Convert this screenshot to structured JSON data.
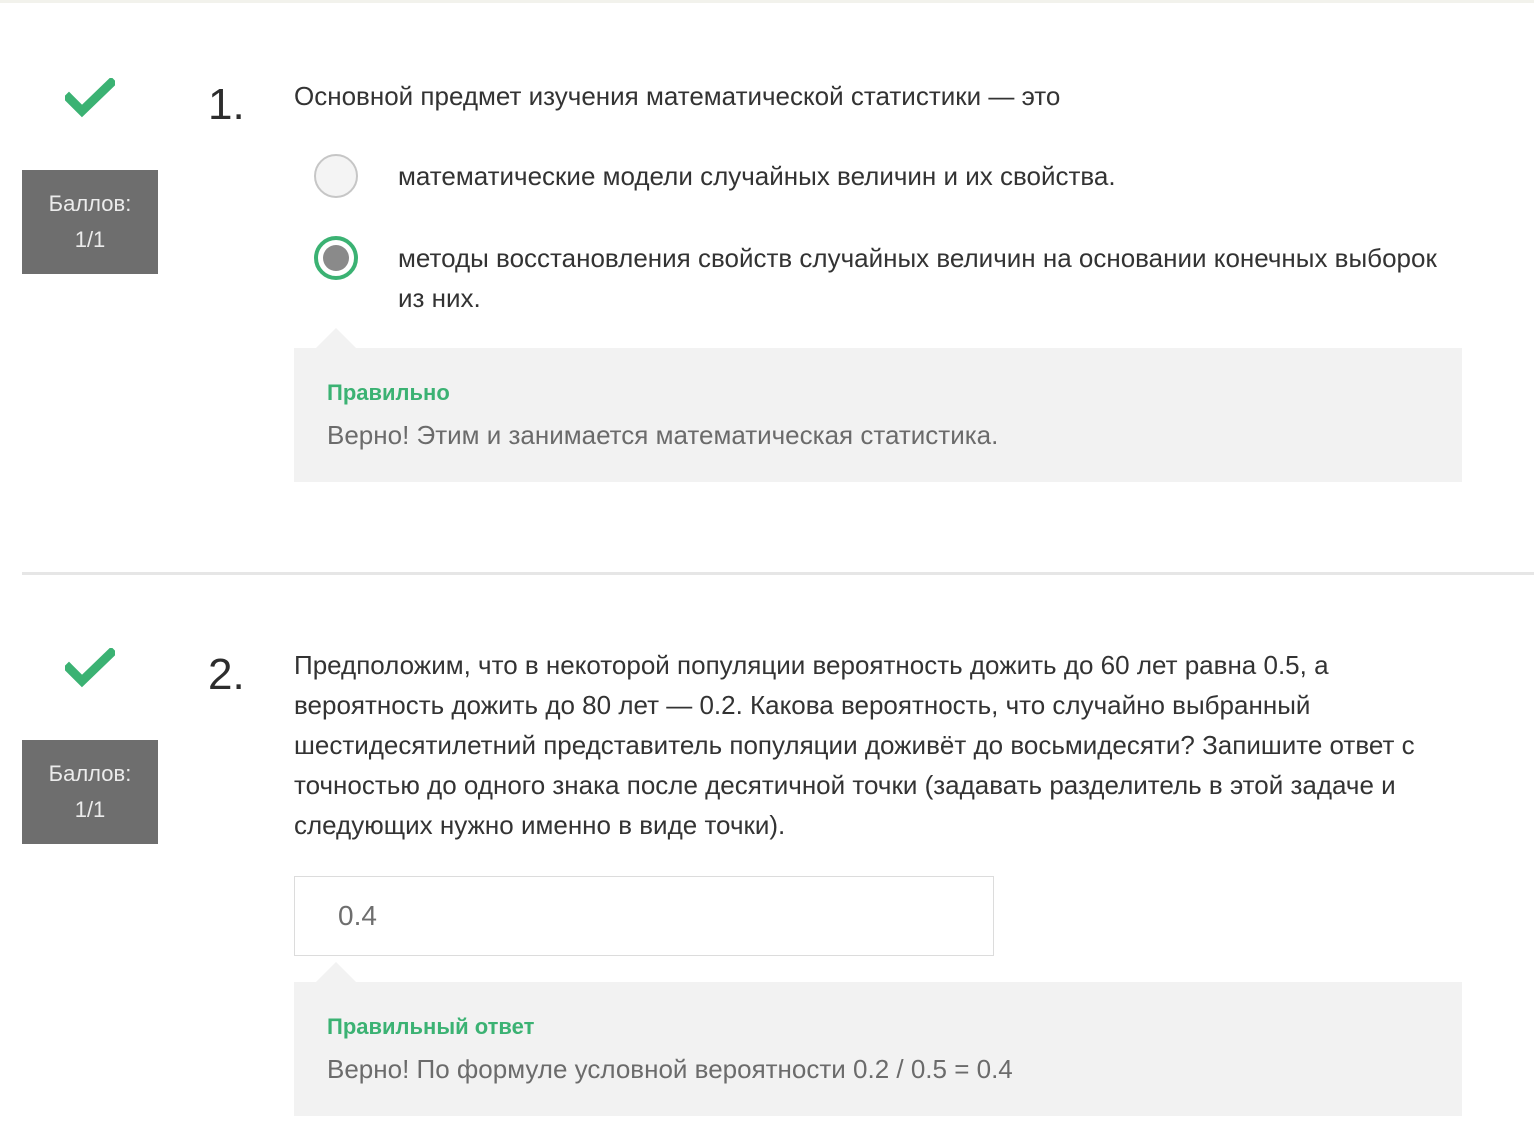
{
  "colors": {
    "accent_green": "#3bb273",
    "score_bg": "#6e6e6e",
    "feedback_bg": "#f2f2f2"
  },
  "questions": [
    {
      "status_icon": "check-icon",
      "score_label": "Баллов:",
      "score_value": "1/1",
      "number": "1.",
      "text": "Основной предмет изучения математической статистики — это",
      "options": [
        {
          "label": "математические модели случайных величин и их свойства.",
          "selected": false
        },
        {
          "label": "методы восстановления свойств случайных величин на основании конечных выборок из них.",
          "selected": true
        }
      ],
      "feedback": {
        "title": "Правильно",
        "text": "Верно! Этим и занимается математическая статистика."
      }
    },
    {
      "status_icon": "check-icon",
      "score_label": "Баллов:",
      "score_value": "1/1",
      "number": "2.",
      "text": "Предположим, что в некоторой популяции вероятность дожить до 60 лет равна 0.5, а вероятность дожить до 80 лет — 0.2. Какова вероятность, что случайно выбранный шестидесятилетний представитель популяции доживёт до восьмидесяти? Запишите ответ с точностью до одного знака после десятичной точки (задавать разделитель в этой задаче и следующих нужно именно в виде точки).",
      "answer_value": "0.4",
      "feedback": {
        "title": "Правильный ответ",
        "text": "Верно! По формуле условной вероятности 0.2 / 0.5 = 0.4"
      }
    }
  ]
}
